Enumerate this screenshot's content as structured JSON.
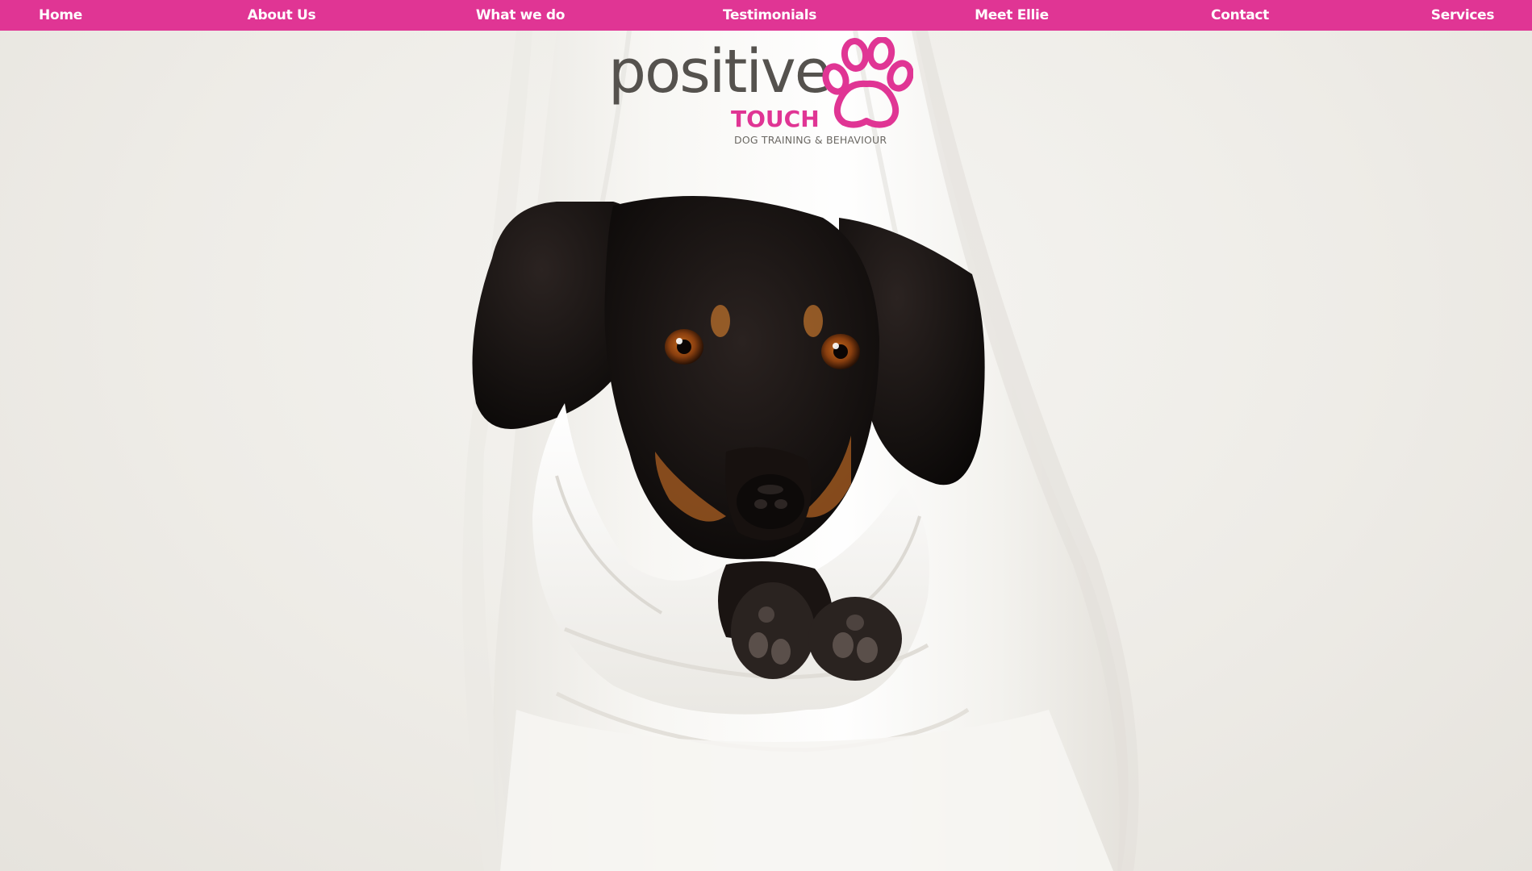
{
  "nav": {
    "items": [
      {
        "label": "Home"
      },
      {
        "label": "About Us"
      },
      {
        "label": "What we do"
      },
      {
        "label": "Testimonials"
      },
      {
        "label": "Meet Ellie"
      },
      {
        "label": "Contact"
      },
      {
        "label": "Services"
      }
    ]
  },
  "logo": {
    "word": "positive",
    "touch": "TOUCH",
    "subtitle": "DOG TRAINING & BEHAVIOUR",
    "icon": "paw-print-icon"
  },
  "hero": {
    "subject": "dachshund-wrapped-in-white-cloth"
  },
  "colors": {
    "brand_pink": "#e03594",
    "logo_grey": "#55524e",
    "background": "#efedea"
  }
}
